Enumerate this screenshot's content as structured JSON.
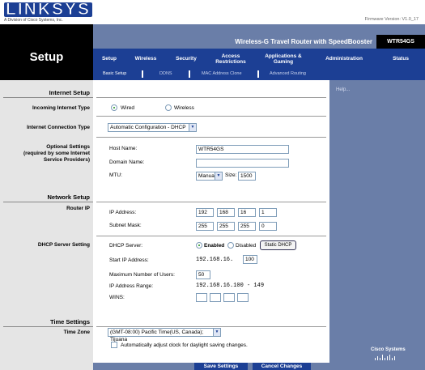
{
  "brand": {
    "logo": "LINKSYS",
    "tagline": "A Division of Cisco Systems, Inc.",
    "firmware": "Firmware Version: V1.0_17",
    "cisco": "Cisco Systems"
  },
  "product": {
    "name": "Wireless-G Travel Router with SpeedBooster",
    "model": "WTR54GS"
  },
  "section_title": "Setup",
  "tabs": [
    {
      "label": "Setup"
    },
    {
      "label": "Wireless"
    },
    {
      "label": "Security"
    },
    {
      "label": "Access Restrictions"
    },
    {
      "label": "Applications & Gaming"
    },
    {
      "label": "Administration"
    },
    {
      "label": "Status"
    }
  ],
  "subtabs": [
    "Basic Setup",
    "DDNS",
    "MAC Address Clone",
    "Advanced Routing"
  ],
  "help": "Help...",
  "left": {
    "internet_setup": "Internet Setup",
    "incoming_type": "Incoming Internet Type",
    "conn_type": "Internet Connection Type",
    "optional": "Optional Settings",
    "optional2": "(required by some Internet",
    "optional3": "Service Providers)",
    "network_setup": "Network Setup",
    "router_ip": "Router IP",
    "dhcp": "DHCP Server Setting",
    "time_settings": "Time Settings",
    "time_zone": "Time Zone"
  },
  "form": {
    "wired": "Wired",
    "wireless": "Wireless",
    "conn_type_value": "Automatic Configuration - DHCP",
    "host_name_label": "Host Name:",
    "host_name": "WTR54GS",
    "domain_name_label": "Domain Name:",
    "domain_name": "",
    "mtu_label": "MTU:",
    "mtu_mode": "Manual",
    "size_label": "Size:",
    "mtu_size": "1500",
    "ip_label": "IP Address:",
    "ip": [
      "192",
      "168",
      "16",
      "1"
    ],
    "mask_label": "Subnet Mask:",
    "mask": [
      "255",
      "255",
      "255",
      "0"
    ],
    "dhcp_label": "DHCP Server:",
    "enabled": "Enabled",
    "disabled": "Disabled",
    "static_dhcp": "Static DHCP",
    "start_ip_label": "Start IP Address:",
    "start_ip_prefix": "192.168.16.",
    "start_ip_last": "100",
    "max_users_label": "Maximum Number of Users:",
    "max_users": "50",
    "range_label": "IP Address Range:",
    "range": "192.168.16.100 - 149",
    "wins_label": "WINS:",
    "tz_value": "(GMT-08:00) Pacific Time(US, Canada); Tijuana",
    "dst_label": "Automatically adjust clock for daylight saving changes."
  },
  "buttons": {
    "save": "Save Settings",
    "cancel": "Cancel Changes"
  }
}
